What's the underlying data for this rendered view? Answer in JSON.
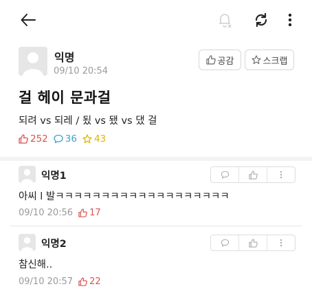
{
  "post": {
    "author": "익명",
    "time": "09/10 20:54",
    "empathize_label": "공감",
    "scrap_label": "스크랩",
    "title": "걸 헤이 문과걸",
    "body": "되려 vs 되레 / 됬 vs 됐 vs 댔 걸",
    "likes": "252",
    "comments": "36",
    "scraps": "43"
  },
  "comments": [
    {
      "author": "익명1",
      "body": "아씨 l 발ㅋㅋㅋㅋㅋㅋㅋㅋㅋㅋㅋㅋㅋㅋㅋㅋㅋㅋㅋ",
      "time": "09/10 20:56",
      "likes": "17"
    },
    {
      "author": "익명2",
      "body": "참신해..",
      "time": "09/10 20:57",
      "likes": "22"
    }
  ],
  "colors": {
    "like": "#d9534f",
    "comment": "#3aa3c9",
    "scrap": "#e0b400"
  },
  "icons": [
    "back-arrow-icon",
    "bell-off-icon",
    "refresh-icon",
    "more-vertical-icon",
    "thumbs-up-icon",
    "speech-bubble-icon",
    "star-icon"
  ]
}
